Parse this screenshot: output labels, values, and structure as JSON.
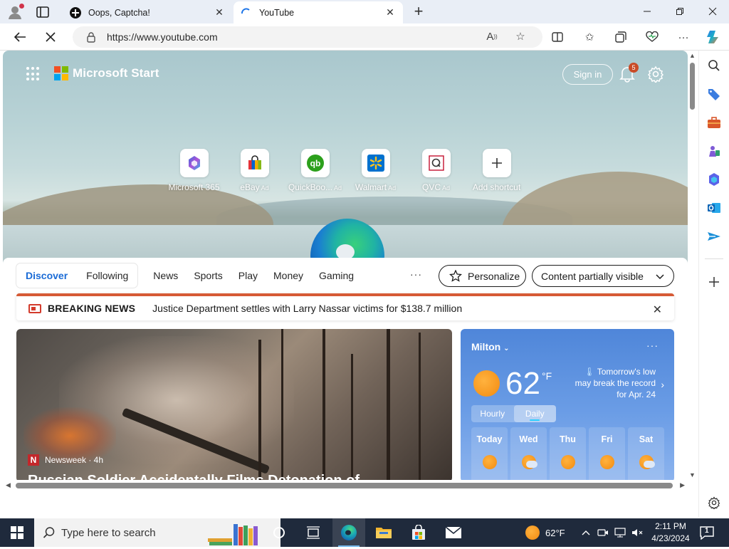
{
  "browser": {
    "tabs": [
      {
        "title": "Oops, Captcha!",
        "active": false
      },
      {
        "title": "YouTube",
        "active": true
      }
    ],
    "url": "https://www.youtube.com"
  },
  "msstart": {
    "brand": "Microsoft Start",
    "signin": "Sign in",
    "notification_count": "5",
    "shortcuts": [
      {
        "label": "Microsoft 365",
        "ad": ""
      },
      {
        "label": "eBay",
        "ad": "Ad"
      },
      {
        "label": "QuickBoo...",
        "ad": "Ad"
      },
      {
        "label": "Walmart",
        "ad": "Ad"
      },
      {
        "label": "QVC",
        "ad": "Ad"
      },
      {
        "label": "Add shortcut",
        "ad": ""
      }
    ]
  },
  "feed": {
    "tabs": {
      "discover": "Discover",
      "following": "Following"
    },
    "nav": [
      "News",
      "Sports",
      "Play",
      "Money",
      "Gaming"
    ],
    "more": "···",
    "personalize": "Personalize",
    "content_visibility": "Content partially visible",
    "breaking": {
      "label": "BREAKING NEWS",
      "text": "Justice Department settles with Larry Nassar victims for $138.7 million"
    },
    "news": {
      "source": "Newsweek · 4h",
      "headline": "Russian Soldier Accidentally Films Detonation of"
    }
  },
  "weather": {
    "city": "Milton",
    "temp": "62",
    "unit": "°F",
    "note": "Tomorrow's low may break the record for Apr. 24",
    "toggle": {
      "hourly": "Hourly",
      "daily": "Daily"
    },
    "days": [
      "Today",
      "Wed",
      "Thu",
      "Fri",
      "Sat"
    ]
  },
  "taskbar": {
    "search_placeholder": "Type here to search",
    "weather": "62°F",
    "time": "2:11 PM",
    "date": "4/23/2024",
    "notification_count": "1"
  },
  "colors": {
    "accent": "#1a6bd6",
    "breaking": "#d65a35",
    "weather_bg": "#5b8fdc",
    "taskbar": "#1f2a3c"
  }
}
